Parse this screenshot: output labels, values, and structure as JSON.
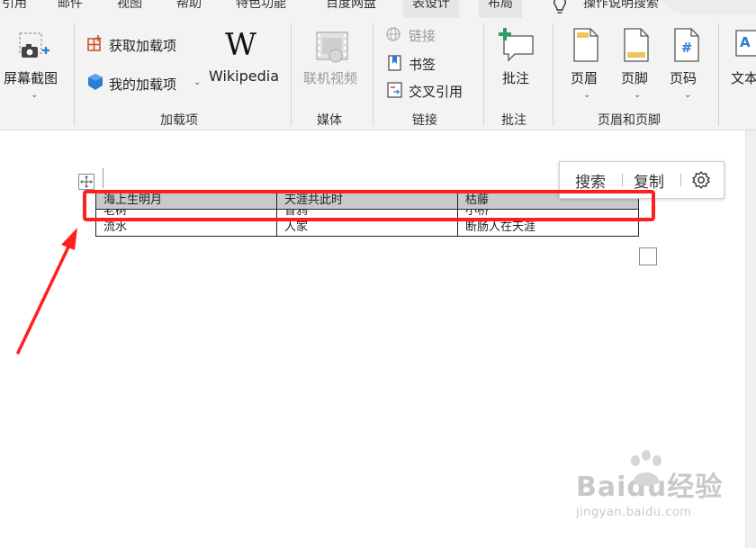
{
  "tabs": [
    "引用",
    "邮件",
    "视图",
    "帮助",
    "特色功能",
    "百度网盘",
    "表设计",
    "布局",
    "操作说明搜索"
  ],
  "ribbon": {
    "screenshot_label": "屏幕截图",
    "get_addins_label": "获取加载项",
    "my_addins_label": "我的加载项",
    "wikipedia_label": "Wikipedia",
    "online_video_label": "联机视频",
    "link_label": "链接",
    "bookmark_label": "书签",
    "cross_ref_label": "交叉引用",
    "comment_label": "批注",
    "header_label": "页眉",
    "footer_label": "页脚",
    "page_number_label": "页码",
    "text_label": "文本",
    "groups": {
      "addins": "加载项",
      "media": "媒体",
      "links": "链接",
      "comments": "批注",
      "header_footer": "页眉和页脚"
    }
  },
  "table": {
    "rows": [
      [
        "海上生明月",
        "天涯共此时",
        "枯藤"
      ],
      [
        "老树",
        "昏鸦",
        "小桥"
      ],
      [
        "流水",
        "人家",
        "断肠人在天涯"
      ]
    ]
  },
  "minibar": {
    "search": "搜索",
    "copy": "复制"
  },
  "watermark": {
    "brand": "Baidu经验",
    "url": "jingyan.baidu.com"
  },
  "colors": {
    "highlight": "#ff1f1f",
    "selection": "#c9c9c9",
    "ribbon_bg": "#f3f3f3"
  }
}
